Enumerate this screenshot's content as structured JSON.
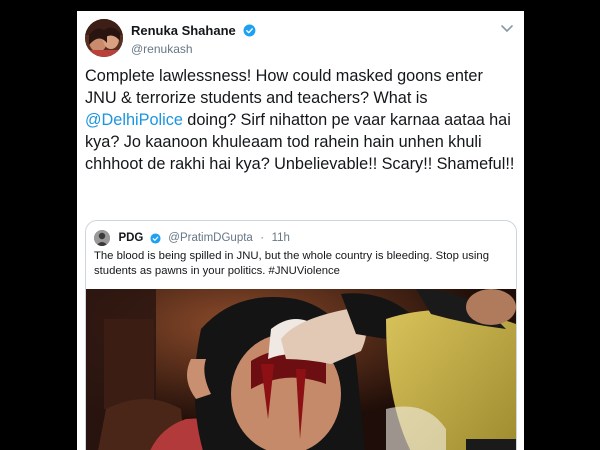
{
  "tweet": {
    "display_name": "Renuka Shahane",
    "handle": "@renukash",
    "verified": true,
    "text_part1": "Complete lawlessness! How could masked goons enter JNU & terrorize students and teachers? What is ",
    "mention": "@DelhiPolice",
    "text_part2": " doing? Sirf nihatton pe vaar karnaa aataa hai kya? Jo kaanoon khuleaam tod rahein hain unhen khuli chhhoot de rakhi hai kya? Unbelievable!! Scary!! Shameful!!"
  },
  "quoted": {
    "display_name": "PDG",
    "handle": "@PratimDGupta",
    "separator": "·",
    "time": "11h",
    "verified": true,
    "text": "The blood is being spilled in JNU, but the whole country is bleeding. Stop using students as pawns in your politics. #JNUViolence"
  },
  "colors": {
    "link": "#1b95e0",
    "verified": "#1da1f2",
    "background": "#000000",
    "card": "#ffffff"
  },
  "icons": {
    "verified": "verified-badge-icon",
    "caret": "chevron-down-icon"
  }
}
